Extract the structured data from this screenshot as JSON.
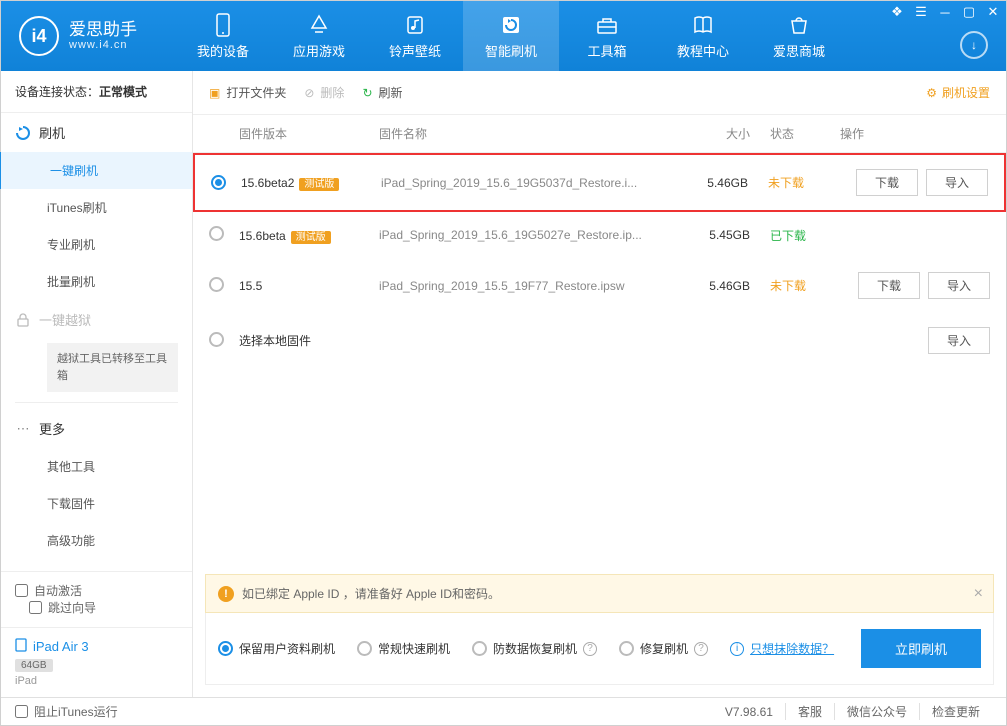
{
  "app": {
    "name": "爱思助手",
    "url": "www.i4.cn"
  },
  "nav": [
    {
      "label": "我的设备",
      "icon": "device"
    },
    {
      "label": "应用游戏",
      "icon": "apps"
    },
    {
      "label": "铃声壁纸",
      "icon": "music"
    },
    {
      "label": "智能刷机",
      "icon": "flash",
      "active": true
    },
    {
      "label": "工具箱",
      "icon": "toolbox"
    },
    {
      "label": "教程中心",
      "icon": "book"
    },
    {
      "label": "爱思商城",
      "icon": "shop"
    }
  ],
  "conn_status": {
    "label": "设备连接状态：",
    "value": "正常模式"
  },
  "sidebar": {
    "flash_head": "刷机",
    "items": [
      "一键刷机",
      "iTunes刷机",
      "专业刷机",
      "批量刷机"
    ],
    "jailbreak": "一键越狱",
    "jailbreak_note": "越狱工具已转移至工具箱",
    "more_head": "更多",
    "more_items": [
      "其他工具",
      "下载固件",
      "高级功能"
    ],
    "auto_activate": "自动激活",
    "skip_guide": "跳过向导",
    "device_name": "iPad Air 3",
    "device_storage": "64GB",
    "device_type": "iPad"
  },
  "toolbar": {
    "open": "打开文件夹",
    "delete": "删除",
    "refresh": "刷新",
    "settings": "刷机设置"
  },
  "table": {
    "headers": {
      "version": "固件版本",
      "name": "固件名称",
      "size": "大小",
      "status": "状态",
      "action": "操作"
    },
    "rows": [
      {
        "version": "15.6beta2",
        "beta": "测试版",
        "name": "iPad_Spring_2019_15.6_19G5037d_Restore.i...",
        "size": "5.46GB",
        "status": "未下载",
        "status_class": "orange",
        "checked": true,
        "highlight": true,
        "actions": [
          "下载",
          "导入"
        ]
      },
      {
        "version": "15.6beta",
        "beta": "测试版",
        "name": "iPad_Spring_2019_15.6_19G5027e_Restore.ip...",
        "size": "5.45GB",
        "status": "已下载",
        "status_class": "green",
        "checked": false,
        "actions": []
      },
      {
        "version": "15.5",
        "beta": "",
        "name": "iPad_Spring_2019_15.5_19F77_Restore.ipsw",
        "size": "5.46GB",
        "status": "未下载",
        "status_class": "orange",
        "checked": false,
        "actions": [
          "下载",
          "导入"
        ]
      },
      {
        "version": "选择本地固件",
        "beta": "",
        "name": "",
        "size": "",
        "status": "",
        "status_class": "",
        "checked": false,
        "actions": [
          "导入"
        ]
      }
    ]
  },
  "notice": "如已绑定 Apple ID ，请准备好 Apple ID和密码。",
  "options": {
    "opt1": "保留用户资料刷机",
    "opt2": "常规快速刷机",
    "opt3": "防数据恢复刷机",
    "opt4": "修复刷机",
    "erase_link": "只想抹除数据？",
    "submit": "立即刷机"
  },
  "footer": {
    "block_itunes": "阻止iTunes运行",
    "version": "V7.98.61",
    "service": "客服",
    "wechat": "微信公众号",
    "update": "检查更新"
  }
}
